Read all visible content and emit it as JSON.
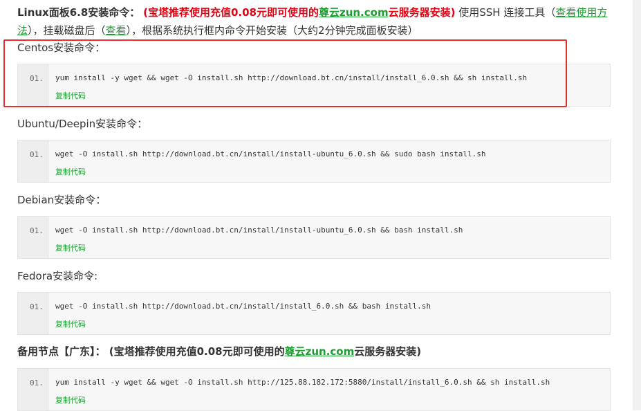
{
  "intro": {
    "lead": "Linux面板6.8安装命令：",
    "red_open": "(宝塔推荐使用充值0.08元即可使用的",
    "brand": "尊云zun.com",
    "red_close": "云服务器安装)",
    "text1": "使用SSH 连接工具（",
    "link1": "查看使用方法",
    "text2": "），挂载磁盘后（",
    "link2": "查看",
    "text3": "），根据系统执行框内命令开始安装（大约2分钟完成面板安装）"
  },
  "sections": [
    {
      "label": "Centos安装命令：",
      "line_no": "01.",
      "command": "yum install -y wget && wget -O install.sh http://download.bt.cn/install/install_6.0.sh && sh install.sh",
      "copy_label": "复制代码"
    },
    {
      "label": "Ubuntu/Deepin安装命令：",
      "line_no": "01.",
      "command": "wget -O install.sh http://download.bt.cn/install/install-ubuntu_6.0.sh && sudo bash install.sh",
      "copy_label": "复制代码"
    },
    {
      "label": "Debian安装命令：",
      "line_no": "01.",
      "command": "wget -O install.sh http://download.bt.cn/install/install-ubuntu_6.0.sh && bash install.sh",
      "copy_label": "复制代码"
    },
    {
      "label": "Fedora安装命令:",
      "line_no": "01.",
      "command": "wget -O install.sh http://download.bt.cn/install/install_6.0.sh && bash install.sh",
      "copy_label": "复制代码"
    }
  ],
  "backup": {
    "lead": "备用节点【广东】：",
    "red_open": "(宝塔推荐使用充值0.08元即可使用的",
    "brand": "尊云zun.com",
    "red_close": "云服务器安装)",
    "line_no": "01.",
    "command": "yum install -y wget && wget -O install.sh http://125.88.182.172:5880/install/install_6.0.sh && sh install.sh",
    "copy_label": "复制代码"
  },
  "colors": {
    "accent_red": "#e60012",
    "link_green": "#1a9e2f",
    "highlight": "#e03030",
    "code_bg": "#f7f7f7"
  }
}
